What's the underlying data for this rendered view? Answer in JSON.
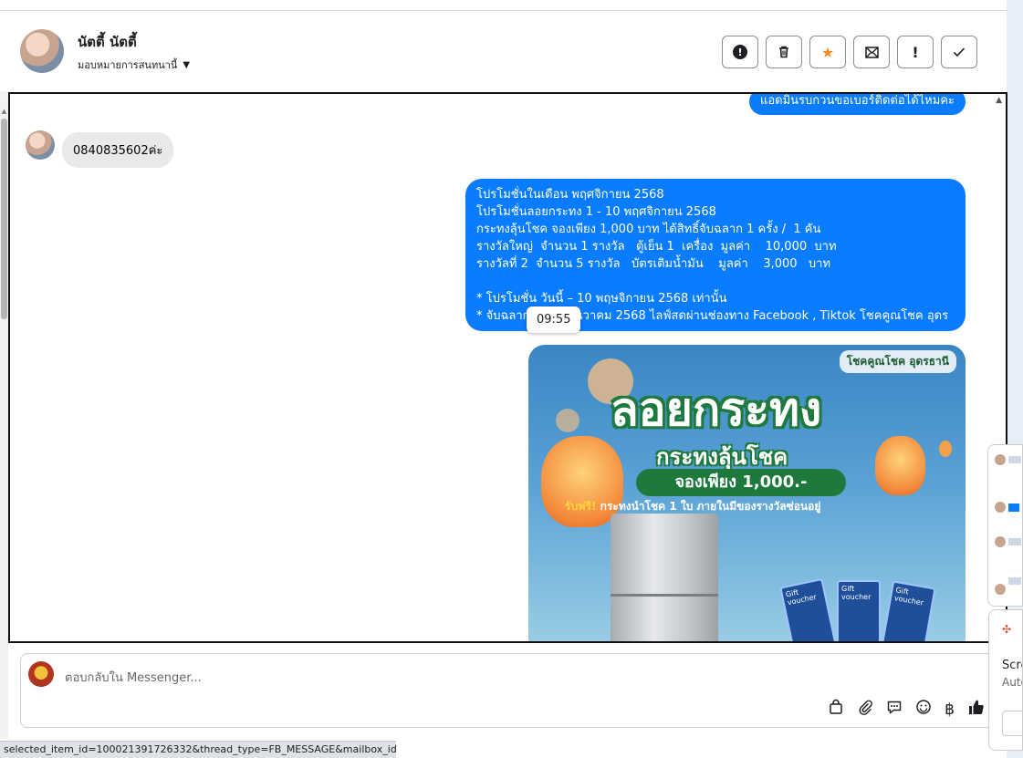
{
  "header": {
    "contact_name": "นัตตี้ นัตตี้",
    "assign_label": "มอบหมายการสนทนานี้",
    "toolbar": [
      {
        "name": "spam-button",
        "icon": "alert-circle-icon"
      },
      {
        "name": "delete-button",
        "icon": "trash-icon"
      },
      {
        "name": "star-button",
        "icon": "star-icon"
      },
      {
        "name": "mark-unread-button",
        "icon": "mail-icon"
      },
      {
        "name": "priority-button",
        "icon": "exclamation-icon"
      },
      {
        "name": "done-button",
        "icon": "check-icon"
      }
    ]
  },
  "messages": {
    "outgoing_top": "แอดมินรบกวนขอเบอร์ติดต่อได้ไหมคะ",
    "incoming_phone": "0840835602ค่ะ",
    "promo_text": "โปรโมชั่นในเดือน พฤศจิกายน 2568\nโปรโมชั่นลอยกระทง 1 - 10 พฤศจิกายน 2568\nกระทงลุ้นโชค จองเพียง 1,000 บาท ได้สิทธิ์จับฉลาก 1 ครั้ง /  1 คัน\nรางวัลใหญ่  จำนวน 1 รางวัล   ตู้เย็น 1  เครื่อง  มูลค่า    10,000  บาท\nรางวัลที่ 2  จำนวน 5 รางวัล   บัตรเติมน้ำมัน    มูลค่า    3,000   บาท\n\n* โปรโมชั่น วันนี้ – 10 พฤษจิกายน 2568 เท่านั้น\n* จับฉลาก          ธันวาคม 2568 ไลฟ์สดผ่านช่องทาง Facebook , Tiktok โชคคูณโชค อุดร",
    "timestamp_tooltip": "09:55"
  },
  "promo_image": {
    "brand": "โชคคูณโชค อุดรธานี",
    "title": "ลอยกระทง",
    "subtitle": "กระทงลุ้นโชค",
    "price_pill": "จองเพียง 1,000.-",
    "free_label": "รับฟรี!",
    "free_text": "กระทงนำโชค 1 ใบ ภายในมีของรางวัลซ่อนอยู่",
    "voucher_label": "Gift voucher"
  },
  "composer": {
    "placeholder": "ตอบกลับใน Messenger...",
    "icons": [
      "bag-icon",
      "attach-icon",
      "saved-reply-icon",
      "emoji-icon",
      "baht-icon",
      "like-icon"
    ]
  },
  "statusbar": {
    "url": "selected_item_id=100021391726332&thread_type=FB_MESSAGE&mailbox_id=#"
  },
  "toast": {
    "title": "Scre",
    "subtitle": "Auto"
  }
}
